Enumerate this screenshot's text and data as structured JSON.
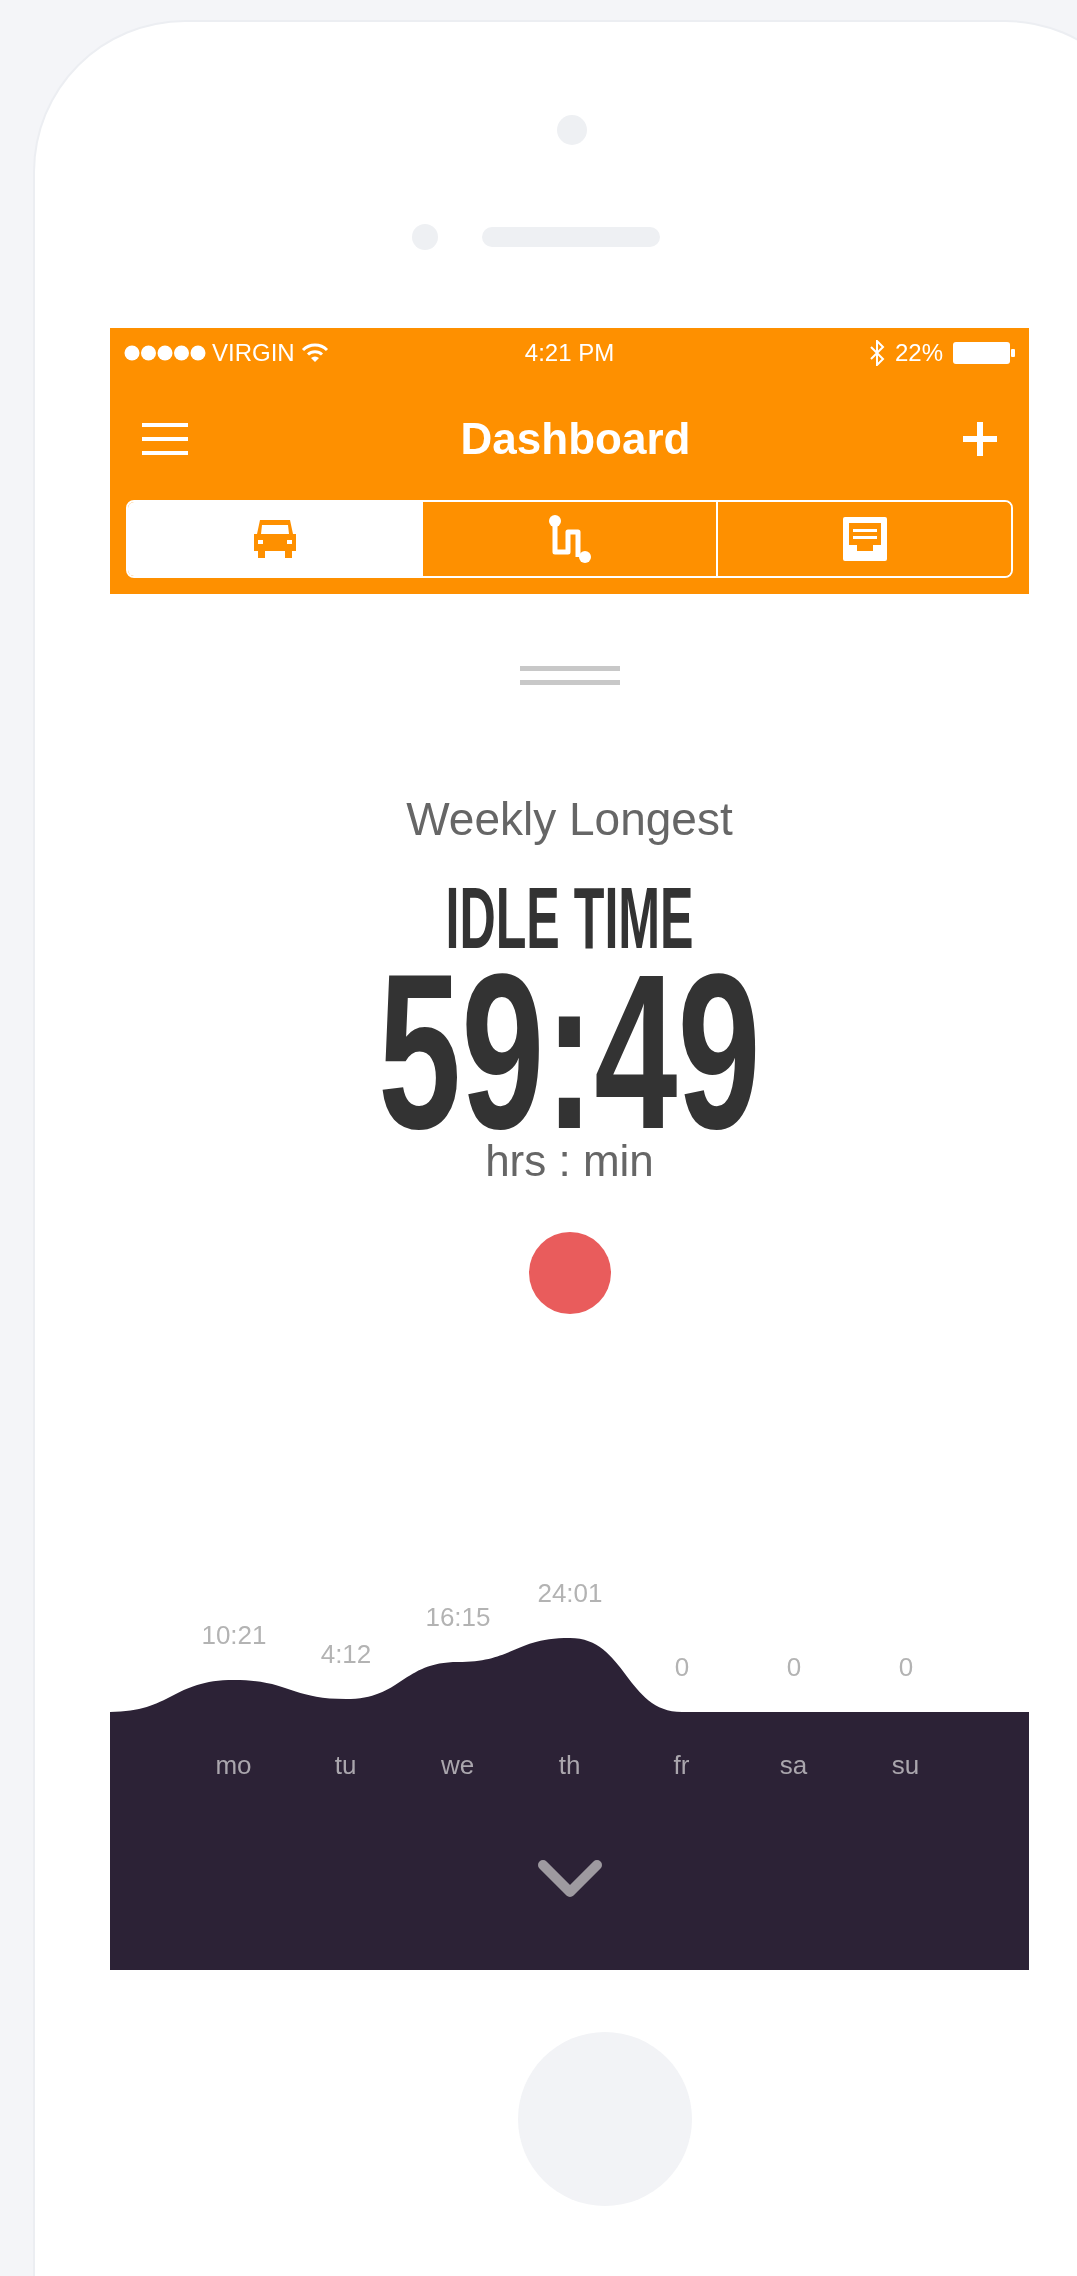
{
  "status_bar": {
    "carrier": "VIRGIN",
    "time": "4:21 PM",
    "battery": "22%"
  },
  "nav": {
    "title": "Dashboard"
  },
  "tabs": [
    {
      "selected": true
    },
    {
      "selected": false
    },
    {
      "selected": false
    }
  ],
  "headline": {
    "subtitle": "Weekly Longest",
    "title": "IDLE TIME",
    "value": "59:49",
    "unit": "hrs : min"
  },
  "days": [
    {
      "label": "mo",
      "value": "10:21"
    },
    {
      "label": "tu",
      "value": "4:12"
    },
    {
      "label": "we",
      "value": "16:15"
    },
    {
      "label": "th",
      "value": "24:01"
    },
    {
      "label": "fr",
      "value": "0"
    },
    {
      "label": "sa",
      "value": "0"
    },
    {
      "label": "su",
      "value": "0"
    }
  ]
}
